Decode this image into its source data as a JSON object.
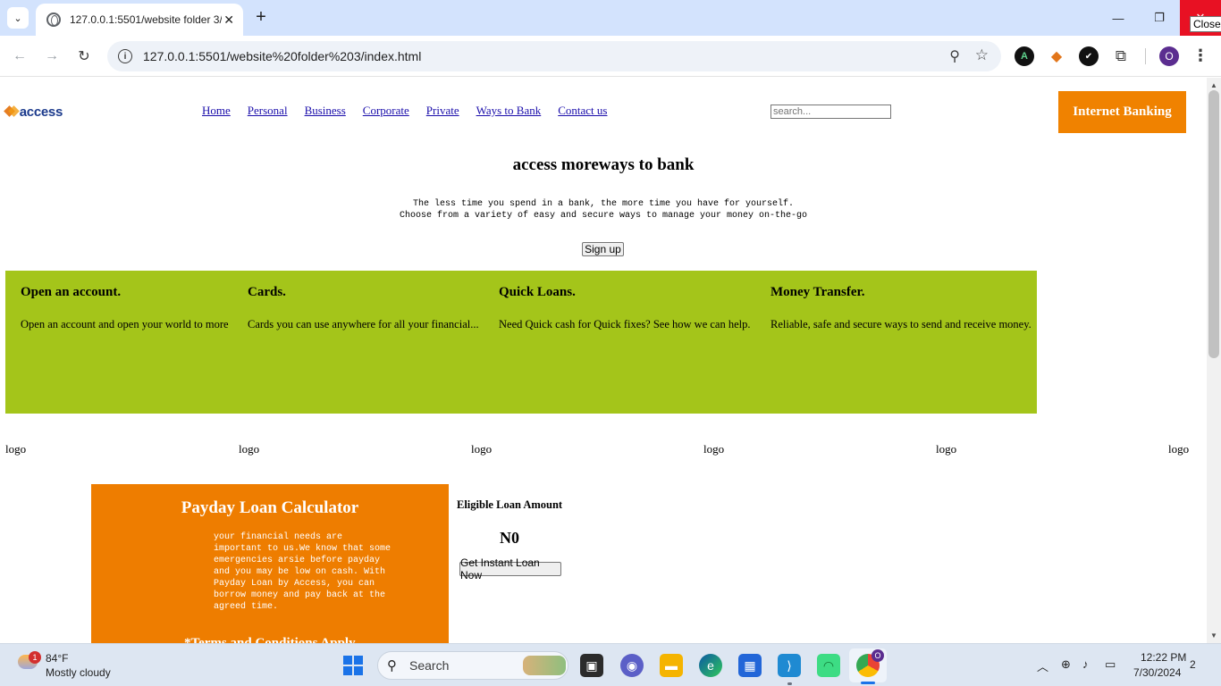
{
  "browser": {
    "tab_title": "127.0.0.1:5501/website folder 3/",
    "url": "127.0.0.1:5501/website%20folder%203/index.html",
    "close_tooltip": "Close",
    "profile_initial": "O",
    "extensions": [
      "a",
      "fox",
      "v",
      "puzzle"
    ]
  },
  "site": {
    "logo_text": "access",
    "nav": [
      "Home",
      "Personal",
      "Business",
      "Corporate",
      "Private",
      "Ways to Bank",
      "Contact us"
    ],
    "search_placeholder": "search...",
    "internet_banking": "Internet Banking",
    "hero": {
      "title": "access moreways to bank",
      "line1": "The less time you spend in a bank, the more time you have for yourself.",
      "line2": "Choose from a variety of easy and secure ways to manage your money on-the-go",
      "signup": "Sign up"
    },
    "features": [
      {
        "title": "Open an account.",
        "text": "Open an account and open your world to more"
      },
      {
        "title": "Cards.",
        "text": "Cards you can use anywhere for all your financial..."
      },
      {
        "title": "Quick Loans.",
        "text": "Need Quick cash for Quick fixes? See how we can help."
      },
      {
        "title": "Money Transfer.",
        "text": "Reliable, safe and secure ways to send and receive money."
      }
    ],
    "logo_alts": [
      "logo",
      "logo",
      "logo",
      "logo",
      "logo",
      "logo"
    ],
    "payday": {
      "title": "Payday Loan Calculator",
      "text": "your financial needs are important to us.We know that some emergencies arsie before payday and you may be low on cash. With Payday Loan by Access, you can borrow money and pay back at the agreed time.",
      "terms": "*Terms and Conditions Apply"
    },
    "loan": {
      "label": "Eligible Loan Amount",
      "amount": "N0",
      "button": "Get Instant Loan Now"
    },
    "colors": {
      "accent_orange": "#f08200",
      "band_green": "#a4c51a",
      "payday_orange": "#ee7d00"
    }
  },
  "taskbar": {
    "weather_badge": "1",
    "temperature": "84°F",
    "condition": "Mostly cloudy",
    "search_label": "Search",
    "chrome_badge": "O",
    "time": "12:22 PM",
    "date": "7/30/2024",
    "notifications": "2"
  }
}
